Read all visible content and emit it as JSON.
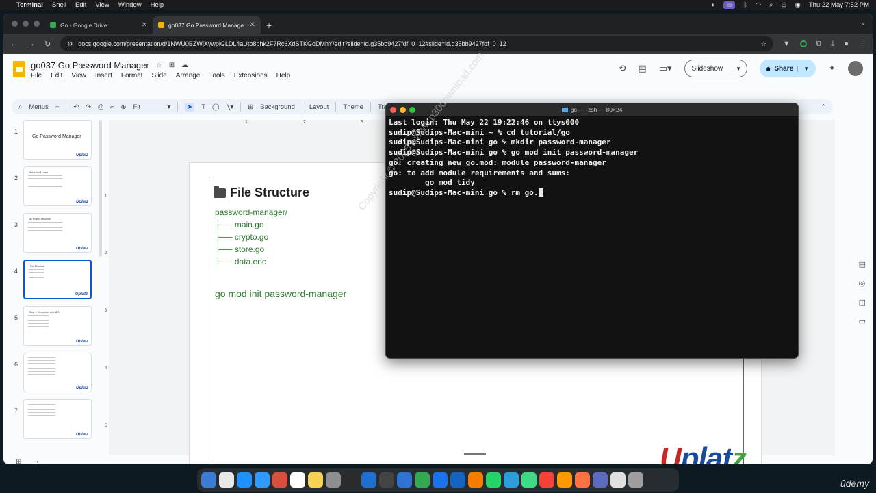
{
  "menubar": {
    "app": "Terminal",
    "items": [
      "Shell",
      "Edit",
      "View",
      "Window",
      "Help"
    ],
    "datetime": "Thu 22 May 7:52 PM"
  },
  "browser": {
    "tabs": [
      {
        "title": "Go - Google Drive",
        "favicon_color": "#34a853"
      },
      {
        "title": "go037 Go Password Manage",
        "favicon_color": "#f4b400"
      }
    ],
    "url": "docs.google.com/presentation/d/1NWU0BZWjXywplGLDL4aUto8phk2F7Rc6XdSTKGoDMhY/edit?slide=id.g35bb9427fdf_0_12#slide=id.g35bb9427fdf_0_12"
  },
  "slides_app": {
    "doc_title": "go037 Go Password Manager",
    "menus": [
      "File",
      "Edit",
      "View",
      "Insert",
      "Format",
      "Slide",
      "Arrange",
      "Tools",
      "Extensions",
      "Help"
    ],
    "slideshow_label": "Slideshow",
    "share_label": "Share",
    "toolbar": {
      "search_label": "Menus",
      "zoom": "Fit",
      "background": "Background",
      "layout": "Layout",
      "theme": "Theme",
      "transition": "Transition"
    },
    "ruler_top": [
      "1",
      "2",
      "3"
    ],
    "ruler_left": [
      "1",
      "2",
      "3",
      "4",
      "5"
    ],
    "thumbnails": [
      {
        "num": "1",
        "title": "Go Password Manager"
      },
      {
        "num": "2",
        "title": "What You'll Learn"
      },
      {
        "num": "3",
        "title": "go Project Structure"
      },
      {
        "num": "4",
        "title": "File Structure"
      },
      {
        "num": "5",
        "title": "Step 1: Encryption with AES"
      },
      {
        "num": "6",
        "title": ""
      },
      {
        "num": "7",
        "title": ""
      }
    ],
    "thumb_logo": "Uplatz",
    "slide": {
      "title": "File Structure",
      "tree_root": "password-manager/",
      "tree_items": [
        "├── main.go",
        "├── crypto.go",
        "├── store.go",
        "├── data.enc"
      ],
      "command": "go mod init password-manager",
      "logo": {
        "first": "U",
        "middle": "plat",
        "last": "z"
      }
    }
  },
  "terminal": {
    "title": "go — -zsh — 80×24",
    "lines": [
      "Last login: Thu May 22 19:22:46 on ttys000",
      "sudip@Sudips-Mac-mini ~ % cd tutorial/go",
      "sudip@Sudips-Mac-mini go % mkdir password-manager",
      "sudip@Sudips-Mac-mini go % go mod init password-manager",
      "go: creating new go.mod: module password-manager",
      "go: to add module requirements and sums:",
      "        go mod tidy"
    ],
    "prompt_line": "sudip@Sudips-Mac-mini go % rm go."
  },
  "watermark": "Copyright © 2025 - www.p30download.com",
  "udemy": "ûdemy",
  "dock_colors": [
    "#3a7bd5",
    "#e8e8e8",
    "#1e90ff",
    "#2f9bff",
    "#d94f3d",
    "#ffffff",
    "#f7d154",
    "#8e8e8e",
    "#2b2b2b",
    "#1f6fd1",
    "#444444",
    "#2e72d2",
    "#34a853",
    "#1a73e8",
    "#1565c0",
    "#f57c00",
    "#25d366",
    "#2d9cdb",
    "#3ddc84",
    "#f44336",
    "#ff9800",
    "#ff7043",
    "#5c6bc0",
    "#e0e0e0",
    "#9e9e9e"
  ]
}
